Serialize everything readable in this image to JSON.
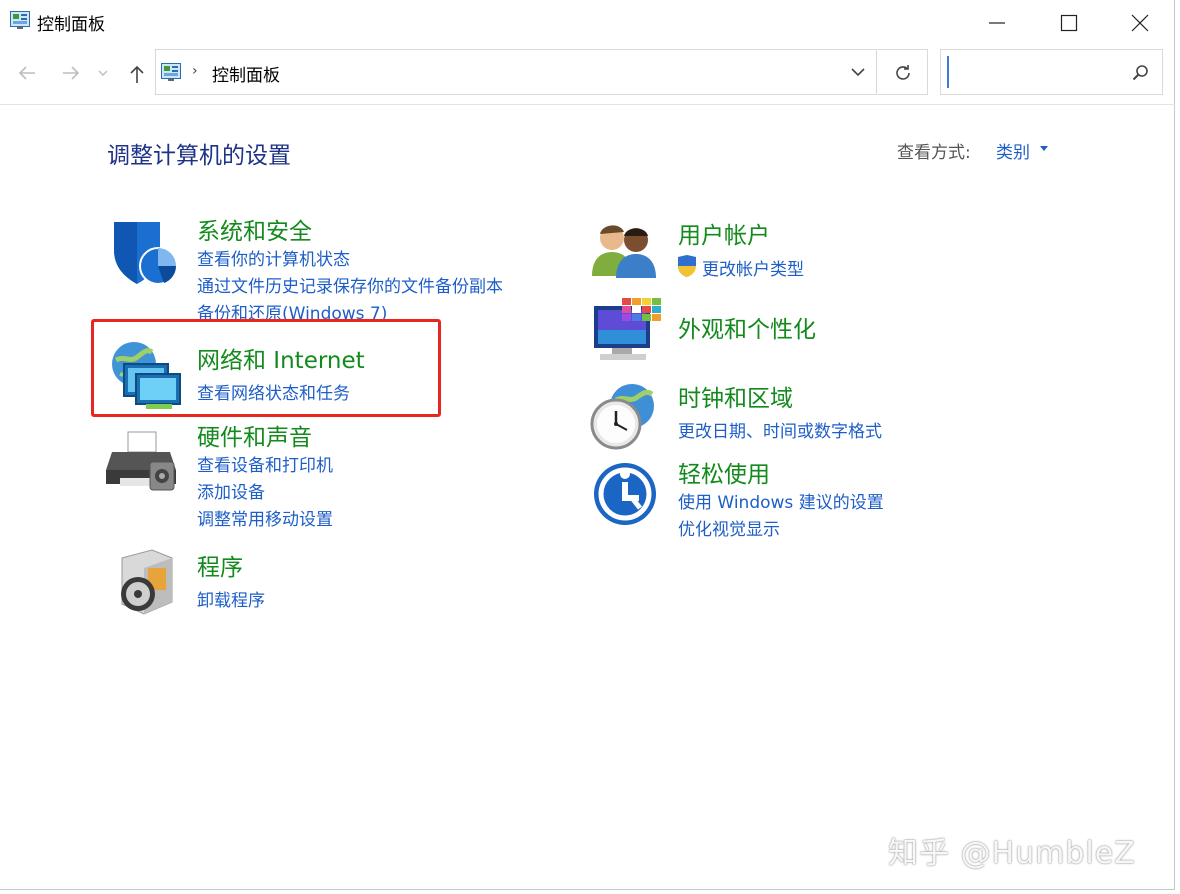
{
  "window": {
    "title": "控制面板",
    "icon": "control-panel-icon",
    "controls": {
      "minimize": "minimize-icon",
      "maximize": "maximize-icon",
      "close": "close-icon"
    }
  },
  "nav": {
    "back_icon": "back-arrow-icon",
    "forward_icon": "forward-arrow-icon",
    "recent_icon": "chevron-down-icon",
    "up_icon": "up-arrow-icon",
    "address_separator": "›",
    "address_text": "控制面板",
    "refresh_icon": "refresh-icon",
    "search_placeholder": "",
    "search_icon": "search-icon"
  },
  "content": {
    "heading": "调整计算机的设置",
    "view_by_label": "查看方式:",
    "view_by_value": "类别",
    "categories": [
      {
        "title": "系统和安全",
        "links": [
          "查看你的计算机状态",
          "通过文件历史记录保存你的文件备份副本",
          "备份和还原(Windows 7)"
        ],
        "icon": "shield-icon"
      },
      {
        "title": "网络和 Internet",
        "links": [
          "查看网络状态和任务"
        ],
        "icon": "network-globe-icon"
      },
      {
        "title": "硬件和声音",
        "links": [
          "查看设备和打印机",
          "添加设备",
          "调整常用移动设置"
        ],
        "icon": "printer-icon"
      },
      {
        "title": "程序",
        "links": [
          "卸载程序"
        ],
        "icon": "programs-disc-icon"
      },
      {
        "title": "用户帐户",
        "links": [
          "更改帐户类型"
        ],
        "icon": "users-icon",
        "link_icon": "uac-shield-icon"
      },
      {
        "title": "外观和个性化",
        "links": [],
        "icon": "monitor-palette-icon"
      },
      {
        "title": "时钟和区域",
        "links": [
          "更改日期、时间或数字格式"
        ],
        "icon": "clock-globe-icon"
      },
      {
        "title": "轻松使用",
        "links": [
          "使用 Windows 建议的设置",
          "优化视觉显示"
        ],
        "icon": "ease-of-access-icon"
      }
    ]
  },
  "watermark": "知乎 @HumbleZ",
  "colors": {
    "category_title": "#128a1c",
    "link": "#1e5ec8",
    "heading": "#1e3287",
    "highlight": "#e8261f"
  }
}
